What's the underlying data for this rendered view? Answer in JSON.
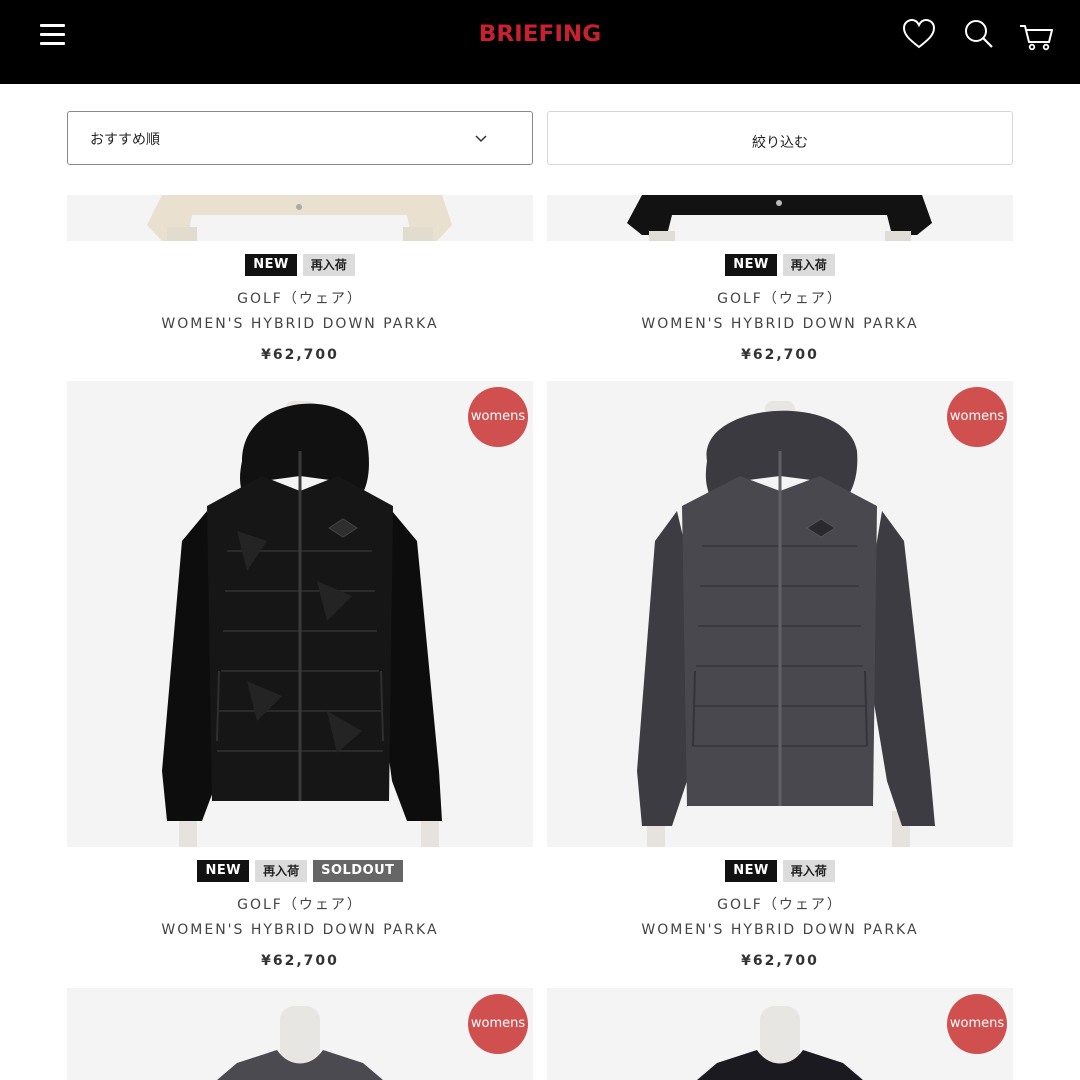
{
  "header": {
    "logo": "BRIEFING",
    "brand_color": "#c8202f",
    "icons": [
      "menu-icon",
      "heart-icon",
      "search-icon",
      "cart-icon"
    ]
  },
  "controls": {
    "sort_label": "おすすめ順",
    "filter_label": "絞り込む"
  },
  "products": [
    {
      "badges": [
        "NEW",
        "再入荷"
      ],
      "category": "GOLF（ウェア）",
      "name": "WOMEN'S HYBRID DOWN PARKA",
      "price": "¥62,700"
    },
    {
      "badges": [
        "NEW",
        "再入荷"
      ],
      "category": "GOLF（ウェア）",
      "name": "WOMEN'S HYBRID DOWN PARKA",
      "price": "¥62,700"
    },
    {
      "badges": [
        "NEW",
        "再入荷",
        "SOLDOUT"
      ],
      "category": "GOLF（ウェア）",
      "name": "WOMEN'S HYBRID DOWN PARKA",
      "price": "¥62,700",
      "tag": "womens"
    },
    {
      "badges": [
        "NEW",
        "再入荷"
      ],
      "category": "GOLF（ウェア）",
      "name": "WOMEN'S HYBRID DOWN PARKA",
      "price": "¥62,700",
      "tag": "womens"
    },
    {
      "tag": "womens"
    },
    {
      "tag": "womens"
    }
  ]
}
